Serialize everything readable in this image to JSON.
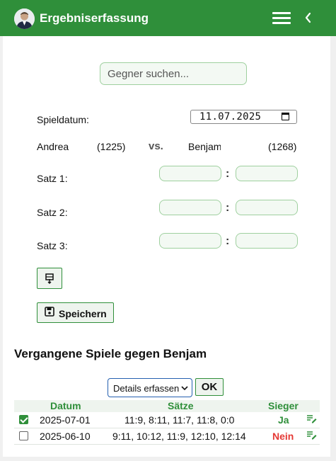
{
  "header": {
    "title": "Ergebniserfassung",
    "brand_color": "#2f8f3a"
  },
  "search": {
    "placeholder": "Gegner suchen..."
  },
  "form": {
    "date_label": "Spieldatum:",
    "date_value": "11.07.2025",
    "player1_name": "Andrea",
    "player1_rating": "(1225)",
    "vs_label": "vs.",
    "player2_name": "Benjam",
    "player2_rating": "(1268)",
    "sets": [
      {
        "label": "Satz 1:"
      },
      {
        "label": "Satz 2:"
      },
      {
        "label": "Satz 3:"
      }
    ],
    "colon": ":",
    "save_label": "Speichern"
  },
  "history": {
    "title": "Vergangene Spiele gegen Benjam",
    "action_select": "Details erfassen",
    "ok_label": "OK",
    "columns": [
      "Datum",
      "Sätze",
      "Sieger"
    ],
    "rows": [
      {
        "checked": true,
        "date": "2025-07-01",
        "sets": "11:9, 8:11, 11:7, 11:8, 0:0",
        "winner": "Ja",
        "winner_color": "#2f8f3a"
      },
      {
        "checked": false,
        "date": "2025-06-10",
        "sets": "9:11, 10:12, 11:9, 12:10, 12:14",
        "winner": "Nein",
        "winner_color": "#e53935"
      }
    ]
  }
}
